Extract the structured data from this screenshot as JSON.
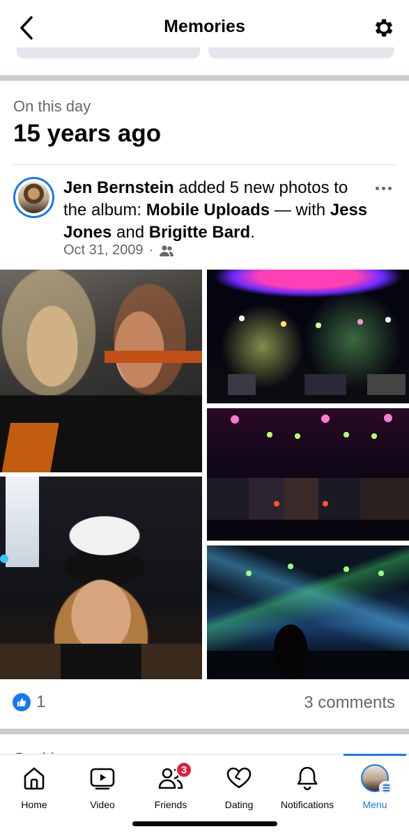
{
  "header": {
    "title": "Memories",
    "back_icon": "chevron-left-icon",
    "settings_icon": "gear-icon"
  },
  "section": {
    "label": "On this day",
    "years": "15 years ago"
  },
  "post": {
    "author": "Jen Bernstein",
    "action": " added 5 new photos to the album: ",
    "album": "Mobile Uploads",
    "with_text": " — with ",
    "tagged_1": "Jess Jones",
    "and_text": " and ",
    "tagged_2": "Brigitte Bard",
    "end": ".",
    "date": "Oct 31, 2009",
    "separator": "·",
    "audience_icon": "friends-audience-icon",
    "photo_count": 5,
    "likes": "1",
    "comments": "3 comments"
  },
  "tabs": [
    {
      "label": "Home",
      "icon": "home-icon"
    },
    {
      "label": "Video",
      "icon": "video-icon"
    },
    {
      "label": "Friends",
      "icon": "friends-icon",
      "badge": "3"
    },
    {
      "label": "Dating",
      "icon": "dating-heart-icon"
    },
    {
      "label": "Notifications",
      "icon": "bell-icon"
    },
    {
      "label": "Menu",
      "icon": "profile-menu-icon",
      "active": true
    }
  ],
  "colors": {
    "accent": "#1877f2",
    "badge": "#e41e3f",
    "secondary_text": "#65676b",
    "divider": "#c9ccd1"
  }
}
